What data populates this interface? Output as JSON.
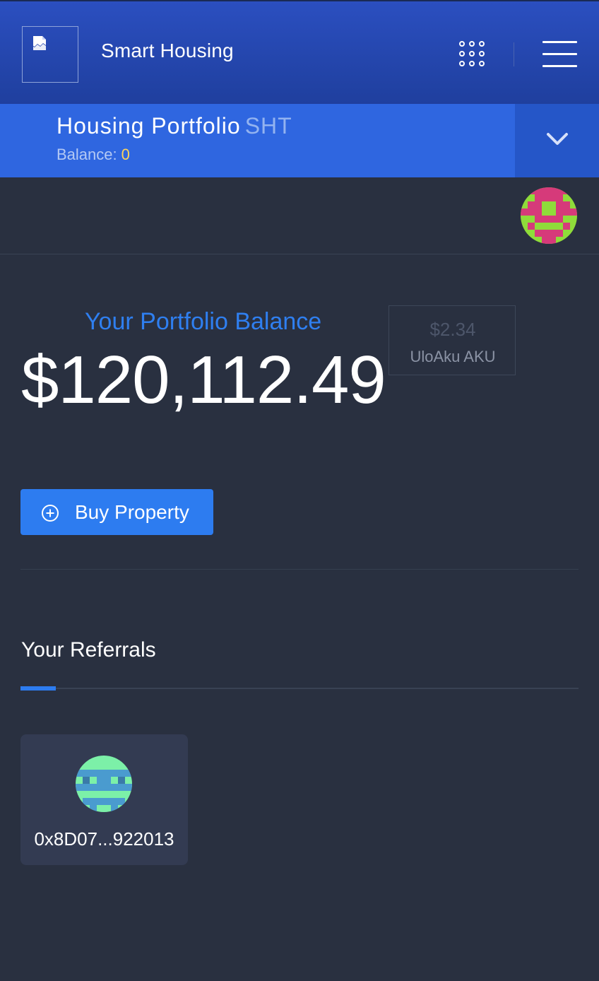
{
  "header": {
    "app_title": "Smart Housing",
    "logo_icon": "broken-image-icon",
    "apps_icon": "apps-grid-icon",
    "menu_icon": "hamburger-menu-icon",
    "colors": {
      "header_bg": "#2b4fc0",
      "accent": "#2d7cf0"
    }
  },
  "portfolio_selector": {
    "title": "Housing Portfolio",
    "ticker": "SHT",
    "balance_label": "Balance:",
    "balance_value": "0",
    "dropdown_icon": "chevron-down-icon"
  },
  "main": {
    "balance_label": "Your Portfolio Balance",
    "balance_amount": "$120,112.49",
    "token": {
      "price": "$2.34",
      "name": "UloAku AKU"
    },
    "buy_button": {
      "label": "Buy Property",
      "icon": "plus-circle-icon"
    }
  },
  "referrals": {
    "title": "Your Referrals",
    "items": [
      {
        "address": "0x8D07...922013"
      }
    ]
  }
}
